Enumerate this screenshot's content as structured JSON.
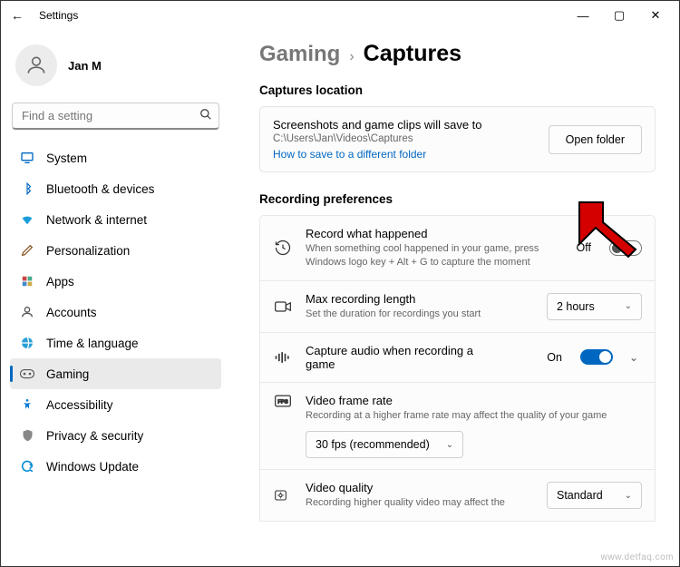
{
  "window": {
    "title": "Settings",
    "controls": {
      "min": "—",
      "max": "▢",
      "close": "✕"
    }
  },
  "user": {
    "name": "Jan M"
  },
  "search": {
    "placeholder": "Find a setting"
  },
  "sidebar": [
    {
      "label": "System"
    },
    {
      "label": "Bluetooth & devices"
    },
    {
      "label": "Network & internet"
    },
    {
      "label": "Personalization"
    },
    {
      "label": "Apps"
    },
    {
      "label": "Accounts"
    },
    {
      "label": "Time & language"
    },
    {
      "label": "Gaming",
      "active": true
    },
    {
      "label": "Accessibility"
    },
    {
      "label": "Privacy & security"
    },
    {
      "label": "Windows Update"
    }
  ],
  "breadcrumb": {
    "parent": "Gaming",
    "current": "Captures"
  },
  "sections": {
    "captures_location": {
      "heading": "Captures location",
      "line1": "Screenshots and game clips will save to",
      "path": "C:\\Users\\Jan\\Videos\\Captures",
      "link": "How to save to a different folder",
      "button": "Open folder"
    },
    "recording_prefs": {
      "heading": "Recording preferences",
      "record_happened": {
        "title": "Record what happened",
        "desc": "When something cool happened in your game, press Windows logo key + Alt + G to capture the moment",
        "state": "Off"
      },
      "max_length": {
        "title": "Max recording length",
        "desc": "Set the duration for recordings you start",
        "value": "2 hours"
      },
      "capture_audio": {
        "title": "Capture audio when recording a game",
        "state": "On"
      },
      "frame_rate": {
        "title": "Video frame rate",
        "desc": "Recording at a higher frame rate may affect the quality of your game",
        "value": "30 fps (recommended)"
      },
      "video_quality": {
        "title": "Video quality",
        "desc": "Recording higher quality video may affect the",
        "value": "Standard"
      }
    }
  },
  "watermark": "www.detfaq.com"
}
